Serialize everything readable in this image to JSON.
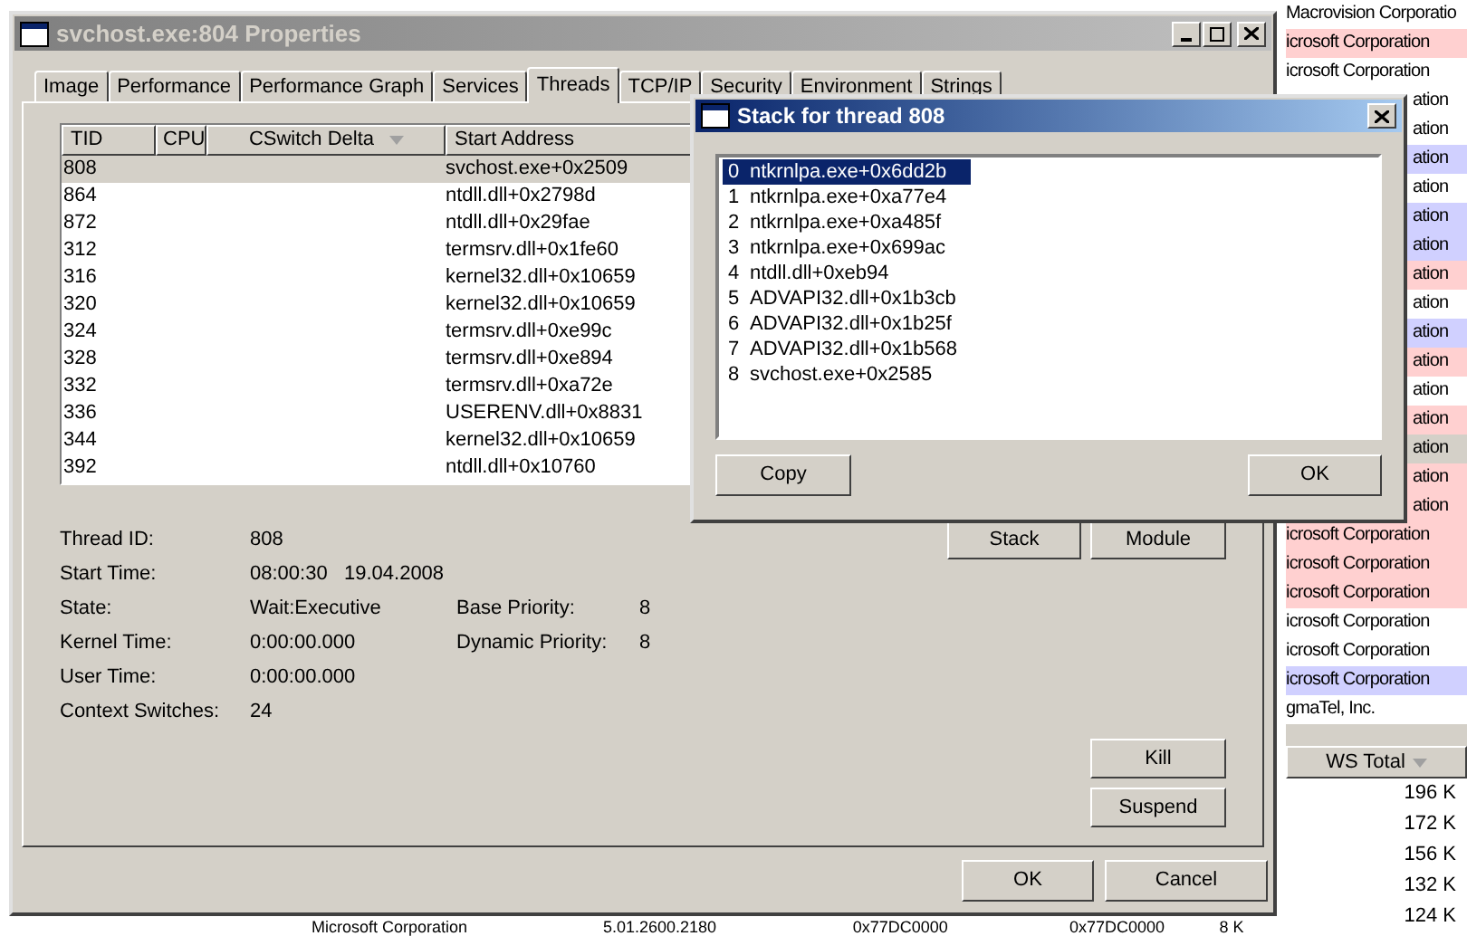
{
  "background_list": {
    "rows": [
      {
        "text": "Macrovision Corporatio",
        "kind": "full",
        "color": "#ffffff"
      },
      {
        "text": "icrosoft Corporation",
        "kind": "full",
        "color": "#ffd0d0"
      },
      {
        "text": "icrosoft Corporation",
        "kind": "full",
        "color": "#ffffff"
      },
      {
        "text": "ation",
        "kind": "clipped",
        "color": "#ffffff"
      },
      {
        "text": "ation",
        "kind": "clipped",
        "color": "#ffffff"
      },
      {
        "text": "ation",
        "kind": "clipped",
        "color": "#d0d0ff"
      },
      {
        "text": "ation",
        "kind": "clipped",
        "color": "#ffffff"
      },
      {
        "text": "ation",
        "kind": "clipped",
        "color": "#d0d0ff"
      },
      {
        "text": "ation",
        "kind": "clipped",
        "color": "#d0d0ff"
      },
      {
        "text": "ation",
        "kind": "clipped",
        "color": "#ffd0d0"
      },
      {
        "text": "ation",
        "kind": "clipped",
        "color": "#ffffff"
      },
      {
        "text": "ation",
        "kind": "clipped",
        "color": "#d0d0ff"
      },
      {
        "text": "ation",
        "kind": "clipped",
        "color": "#ffd0d0"
      },
      {
        "text": "ation",
        "kind": "clipped",
        "color": "#ffffff"
      },
      {
        "text": "ation",
        "kind": "clipped",
        "color": "#ffd0d0"
      },
      {
        "text": "ation",
        "kind": "clipped",
        "color": "#d4d0c8"
      },
      {
        "text": "ation",
        "kind": "clipped",
        "color": "#ffd0d0"
      },
      {
        "text": "ation",
        "kind": "clipped",
        "color": "#ffd0d0"
      },
      {
        "text": "icrosoft Corporation",
        "kind": "full",
        "color": "#ffd0d0"
      },
      {
        "text": "icrosoft Corporation",
        "kind": "full",
        "color": "#ffd0d0"
      },
      {
        "text": "icrosoft Corporation",
        "kind": "full",
        "color": "#ffd0d0"
      },
      {
        "text": "icrosoft Corporation",
        "kind": "full",
        "color": "#ffffff"
      },
      {
        "text": "icrosoft Corporation",
        "kind": "full",
        "color": "#ffffff"
      },
      {
        "text": "icrosoft Corporation",
        "kind": "full",
        "color": "#d0d0ff"
      },
      {
        "text": "gmaTel, Inc.",
        "kind": "full",
        "color": "#ffffff"
      }
    ],
    "column_header": "WS Total",
    "values": [
      "196 K",
      "172 K",
      "156 K",
      "132 K",
      "124 K"
    ],
    "bottom_row": [
      "Microsoft Corporation",
      "5.01.2600.2180",
      "0x77DC0000",
      "0x77DC0000",
      "8 K"
    ]
  },
  "properties_window": {
    "title": "svchost.exe:804 Properties",
    "tabs": [
      {
        "label": "Image",
        "selected": false
      },
      {
        "label": "Performance",
        "selected": false
      },
      {
        "label": "Performance Graph",
        "selected": false
      },
      {
        "label": "Services",
        "selected": false
      },
      {
        "label": "Threads",
        "selected": true
      },
      {
        "label": "TCP/IP",
        "selected": false
      },
      {
        "label": "Security",
        "selected": false
      },
      {
        "label": "Environment",
        "selected": false
      },
      {
        "label": "Strings",
        "selected": false
      }
    ],
    "columns": [
      "TID",
      "CPU",
      "CSwitch Delta",
      "Start Address"
    ],
    "threads": [
      {
        "tid": "808",
        "start_address": "svchost.exe+0x2509",
        "selected": true
      },
      {
        "tid": "864",
        "start_address": "ntdll.dll+0x2798d",
        "selected": false
      },
      {
        "tid": "872",
        "start_address": "ntdll.dll+0x29fae",
        "selected": false
      },
      {
        "tid": "312",
        "start_address": "termsrv.dll+0x1fe60",
        "selected": false
      },
      {
        "tid": "316",
        "start_address": "kernel32.dll+0x10659",
        "selected": false
      },
      {
        "tid": "320",
        "start_address": "kernel32.dll+0x10659",
        "selected": false
      },
      {
        "tid": "324",
        "start_address": "termsrv.dll+0xe99c",
        "selected": false
      },
      {
        "tid": "328",
        "start_address": "termsrv.dll+0xe894",
        "selected": false
      },
      {
        "tid": "332",
        "start_address": "termsrv.dll+0xa72e",
        "selected": false
      },
      {
        "tid": "336",
        "start_address": "USERENV.dll+0x8831",
        "selected": false
      },
      {
        "tid": "344",
        "start_address": "kernel32.dll+0x10659",
        "selected": false
      },
      {
        "tid": "392",
        "start_address": "ntdll.dll+0x10760",
        "selected": false
      }
    ],
    "details": [
      [
        {
          "label": "Thread ID:",
          "value": "808"
        }
      ],
      [
        {
          "label": "Start Time:",
          "value": "08:00:30   19.04.2008"
        }
      ],
      [
        {
          "label": "State:",
          "value": "Wait:Executive"
        },
        {
          "label": "Base Priority:",
          "value": "8"
        }
      ],
      [
        {
          "label": "Kernel Time:",
          "value": "0:00:00.000"
        },
        {
          "label": "Dynamic Priority:",
          "value": "8"
        }
      ],
      [
        {
          "label": "User Time:",
          "value": "0:00:00.000"
        }
      ],
      [
        {
          "label": "Context Switches:",
          "value": "24"
        }
      ]
    ],
    "stack_button": "Stack",
    "module_button": "Module",
    "kill_button": "Kill",
    "suspend_button": "Suspend",
    "ok_button": "OK",
    "cancel_button": "Cancel"
  },
  "stack_dialog": {
    "title": "Stack for thread 808",
    "frames": [
      {
        "index": "0",
        "text": "ntkrnlpa.exe+0x6dd2b",
        "selected": true
      },
      {
        "index": "1",
        "text": "ntkrnlpa.exe+0xa77e4",
        "selected": false
      },
      {
        "index": "2",
        "text": "ntkrnlpa.exe+0xa485f",
        "selected": false
      },
      {
        "index": "3",
        "text": "ntkrnlpa.exe+0x699ac",
        "selected": false
      },
      {
        "index": "4",
        "text": "ntdll.dll+0xeb94",
        "selected": false
      },
      {
        "index": "5",
        "text": "ADVAPI32.dll+0x1b3cb",
        "selected": false
      },
      {
        "index": "6",
        "text": "ADVAPI32.dll+0x1b25f",
        "selected": false
      },
      {
        "index": "7",
        "text": "ADVAPI32.dll+0x1b568",
        "selected": false
      },
      {
        "index": "8",
        "text": "svchost.exe+0x2585",
        "selected": false
      }
    ],
    "copy_button": "Copy",
    "ok_button": "OK"
  }
}
